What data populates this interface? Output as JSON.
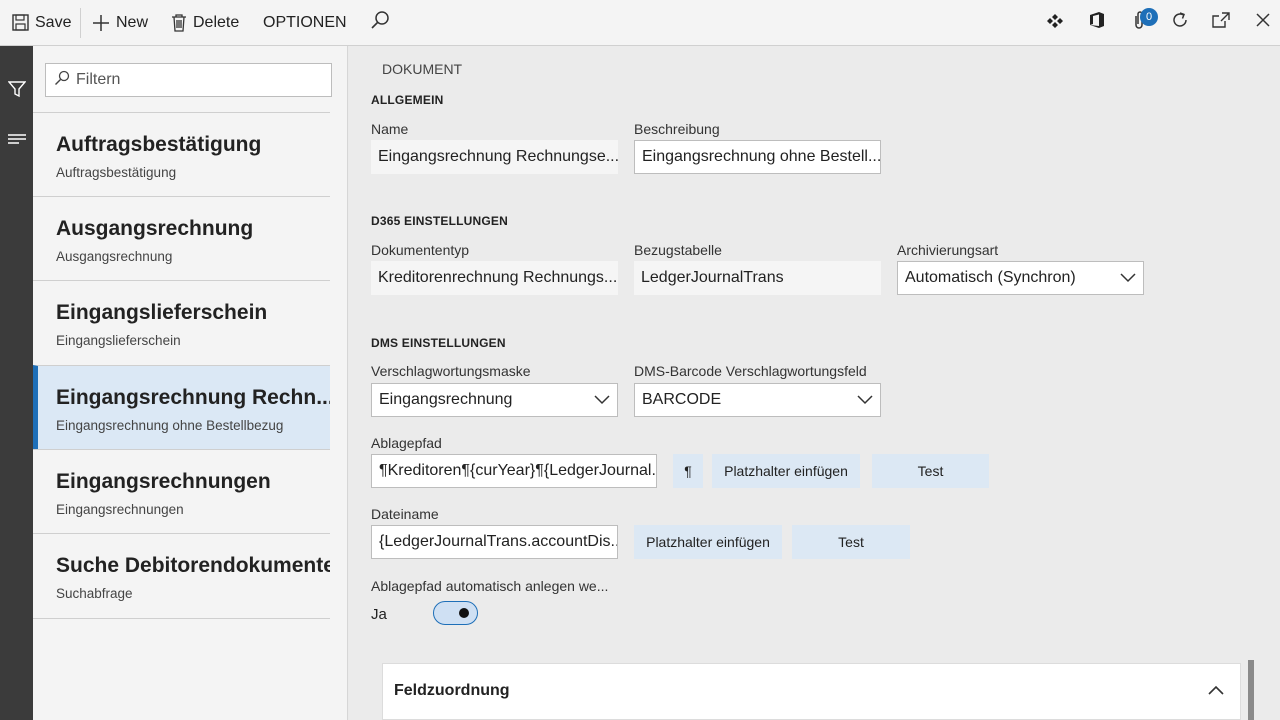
{
  "toolbar": {
    "save_label": "Save",
    "new_label": "New",
    "delete_label": "Delete",
    "options_label": "OPTIONEN",
    "notification_count": "0"
  },
  "filter": {
    "placeholder": "Filtern"
  },
  "list": {
    "items": [
      {
        "title": "Auftragsbestätigung",
        "subtitle": "Auftragsbestätigung"
      },
      {
        "title": "Ausgangsrechnung",
        "subtitle": "Ausgangsrechnung"
      },
      {
        "title": "Eingangslieferschein",
        "subtitle": "Eingangslieferschein"
      },
      {
        "title": "Eingangsrechnung Rechn...",
        "subtitle": "Eingangsrechnung ohne Bestellbezug"
      },
      {
        "title": "Eingangsrechnungen",
        "subtitle": "Eingangsrechnungen"
      },
      {
        "title": "Suche Debitorendokumente",
        "subtitle": "Suchabfrage"
      }
    ],
    "selected_index": 3
  },
  "form": {
    "page_label": "DOKUMENT",
    "general": {
      "header": "ALLGEMEIN",
      "name_label": "Name",
      "name_value": "Eingangsrechnung Rechnungse...",
      "desc_label": "Beschreibung",
      "desc_value": "Eingangsrechnung ohne Bestell..."
    },
    "d365": {
      "header": "D365 EINSTELLUNGEN",
      "doctype_label": "Dokumententyp",
      "doctype_value": "Kreditorenrechnung Rechnungs...",
      "reftable_label": "Bezugstabelle",
      "reftable_value": "LedgerJournalTrans",
      "archive_label": "Archivierungsart",
      "archive_value": "Automatisch (Synchron)"
    },
    "dms": {
      "header": "DMS EINSTELLUNGEN",
      "mask_label": "Verschlagwortungsmaske",
      "mask_value": "Eingangsrechnung",
      "barcode_label": "DMS-Barcode Verschlagwortungsfeld",
      "barcode_value": "BARCODE",
      "path_label": "Ablagepfad",
      "path_value": "¶Kreditoren¶{curYear}¶{LedgerJournal...",
      "pilcrow_label": "¶",
      "insert_placeholder_label": "Platzhalter einfügen",
      "test_label": "Test",
      "filename_label": "Dateiname",
      "filename_value": "{LedgerJournalTrans.accountDis...",
      "autocreate_label": "Ablagepfad automatisch anlegen we...",
      "autocreate_value": "Ja",
      "autocreate_on": true
    },
    "fasttab": {
      "title": "Feldzuordnung"
    }
  },
  "colors": {
    "accent": "#1e6fb8",
    "selected_bg": "#dbe8f5",
    "button_bg": "#dce8f4",
    "rail": "#3b3b3b"
  }
}
